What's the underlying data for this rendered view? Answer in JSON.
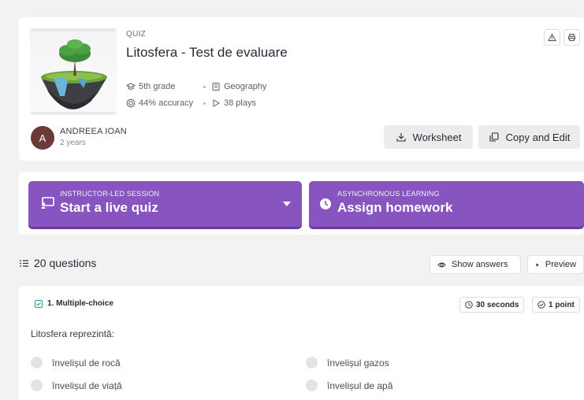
{
  "quiz": {
    "kind": "QUIZ",
    "title": "Litosfera - Test de evaluare",
    "grade": "5th grade",
    "subject": "Geography",
    "accuracy": "44% accuracy",
    "plays": "38 plays",
    "author": "ANDREEA IOAN",
    "age": "2 years",
    "avatar_letter": "A",
    "worksheet_label": "Worksheet",
    "copy_edit_label": "Copy and Edit"
  },
  "session": {
    "live": {
      "sub": "INSTRUCTOR-LED SESSION",
      "main": "Start a live quiz"
    },
    "homework": {
      "sub": "ASYNCHRONOUS LEARNING",
      "main": "Assign homework"
    }
  },
  "questions_header": {
    "count": "20 questions",
    "show_answers": "Show answers",
    "preview": "Preview"
  },
  "question": {
    "type": "1. Multiple-choice",
    "time": "30 seconds",
    "points": "1 point",
    "text": "Litosfera reprezintă:",
    "options": [
      "învelișul de rocă",
      "învelișul gazos",
      "învelișul de viață",
      "învelișul de apă"
    ]
  },
  "colors": {
    "accent": "#8854c0",
    "accent_shadow": "#6c3b9f",
    "avatar": "#6a3a36",
    "background": "#f2f2f2"
  },
  "icons": [
    "graduation-cap-icon",
    "book-icon",
    "target-icon",
    "play-icon",
    "warning-icon",
    "print-icon",
    "download-icon",
    "copy-icon",
    "presentation-icon",
    "chevron-down-icon",
    "clock-icon",
    "list-icon",
    "eye-icon",
    "checkbox-icon",
    "check-circle-icon"
  ]
}
